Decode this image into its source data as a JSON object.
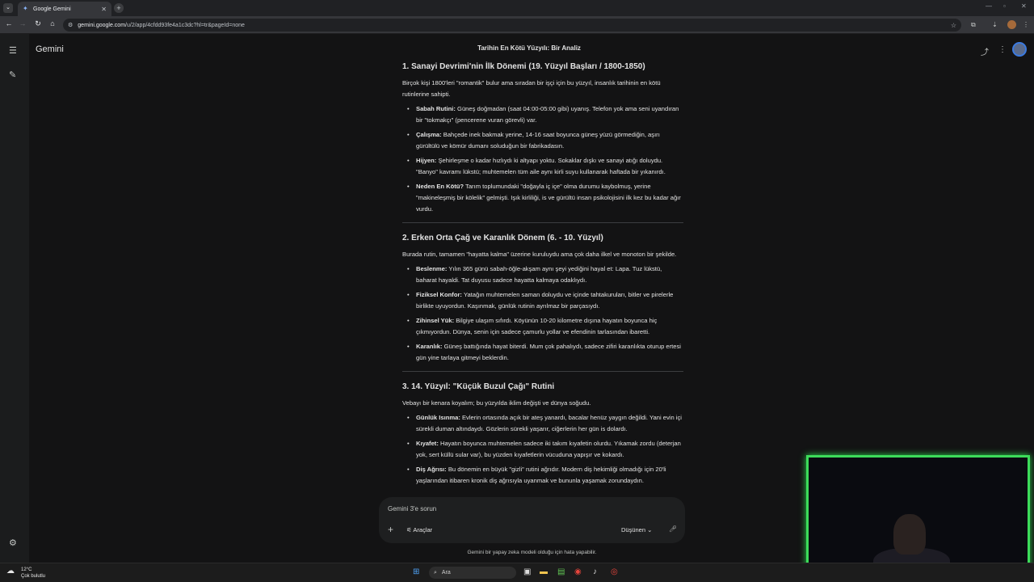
{
  "browser": {
    "tab_title": "Google Gemini",
    "url_host": "gemini.google.com",
    "url_path": "/u/2/app/4cfdd93fe4a1c3dc?hl=tr&pageId=none"
  },
  "app": {
    "brand": "Gemini",
    "conversation_title": "Tarihin En Kötü Yüzyılı: Bir Analiz"
  },
  "sections": [
    {
      "heading": "1. Sanayi Devrimi'nin İlk Dönemi (19. Yüzyıl Başları / 1800-1850)",
      "intro": "Birçok kişi 1800'leri \"romantik\" bulur ama sıradan bir işçi için bu yüzyıl, insanlık tarihinin en kötü rutinlerine sahipti.",
      "items": [
        {
          "label": "Sabah Rutini:",
          "text": " Güneş doğmadan (saat 04:00-05:00 gibi) uyanış. Telefon yok ama seni uyandıran bir \"tokmakçı\" (pencerene vuran görevli) var."
        },
        {
          "label": "Çalışma:",
          "text": " Bahçede inek bakmak yerine, 14-16 saat boyunca güneş yüzü görmediğin, aşırı gürültülü ve kömür dumanı soluduğun bir fabrikadasın."
        },
        {
          "label": "Hijyen:",
          "text": " Şehirleşme o kadar hızlıydı ki altyapı yoktu. Sokaklar dışkı ve sanayi atığı doluydu. \"Banyo\" kavramı lükstü; muhtemelen tüm aile aynı kirli suyu kullanarak haftada bir yıkanırdı."
        },
        {
          "label": "Neden En Kötü?",
          "text": " Tarım toplumundaki \"doğayla iç içe\" olma durumu kaybolmuş, yerine \"makineleşmiş bir kölelik\" gelmişti. Işık kirliliği, is ve gürültü insan psikolojisini ilk kez bu kadar ağır vurdu."
        }
      ]
    },
    {
      "heading": "2. Erken Orta Çağ ve Karanlık Dönem (6. - 10. Yüzyıl)",
      "intro": "Burada rutin, tamamen \"hayatta kalma\" üzerine kuruluydu ama çok daha ilkel ve monoton bir şekilde.",
      "items": [
        {
          "label": "Beslenme:",
          "text": " Yılın 365 günü sabah-öğle-akşam aynı şeyi yediğini hayal et: Lapa. Tuz lükstü, baharat hayaldi. Tat duyusu sadece hayatta kalmaya odaklıydı."
        },
        {
          "label": "Fiziksel Konfor:",
          "text": " Yatağın muhtemelen saman doluydu ve içinde tahtakuruları, bitler ve pirelerle birlikte uyuyordun. Kaşınmak, günlük rutinin ayrılmaz bir parçasıydı."
        },
        {
          "label": "Zihinsel Yük:",
          "text": " Bilgiye ulaşım sıfırdı. Köyünün 10-20 kilometre dışına hayatın boyunca hiç çıkmıyordun. Dünya, senin için sadece çamurlu yollar ve efendinin tarlasından ibaretti."
        },
        {
          "label": "Karanlık:",
          "text": " Güneş battığında hayat biterdi. Mum çok pahalıydı, sadece zifiri karanlıkta oturup ertesi gün yine tarlaya gitmeyi beklerdin."
        }
      ]
    },
    {
      "heading": "3. 14. Yüzyıl: \"Küçük Buzul Çağı\" Rutini",
      "intro": "Vebayı bir kenara koyalım; bu yüzyılda iklim değişti ve dünya soğudu.",
      "items": [
        {
          "label": "Günlük Isınma:",
          "text": " Evlerin ortasında açık bir ateş yanardı, bacalar henüz yaygın değildi. Yani evin içi sürekli duman altındaydı. Gözlerin sürekli yaşarır, ciğerlerin her gün is dolardı."
        },
        {
          "label": "Kıyafet:",
          "text": " Hayatın boyunca muhtemelen sadece iki takım kıyafetin olurdu. Yıkamak zordu (deterjan yok, sert küllü sular var), bu yüzden kıyafetlerin vücuduna yapışır ve kokardı."
        },
        {
          "label": "Diş Ağrısı:",
          "text": " Bu dönemin en büyük \"gizli\" rutini ağrıdır. Modern diş hekimliği olmadığı için 20'li yaşlarından itibaren kronik diş ağrısıyla uyanmak ve bununla yaşamak zorundaydın."
        }
      ]
    }
  ],
  "composer": {
    "placeholder": "Gemini 3'e sorun",
    "tools_label": "Araçlar",
    "mode_label": "Düşünen"
  },
  "disclaimer": "Gemini bir yapay zeka modeli olduğu için hata yapabilir.",
  "taskbar": {
    "temperature": "12°C",
    "condition": "Çok bulutlu",
    "search_placeholder": "Ara"
  }
}
